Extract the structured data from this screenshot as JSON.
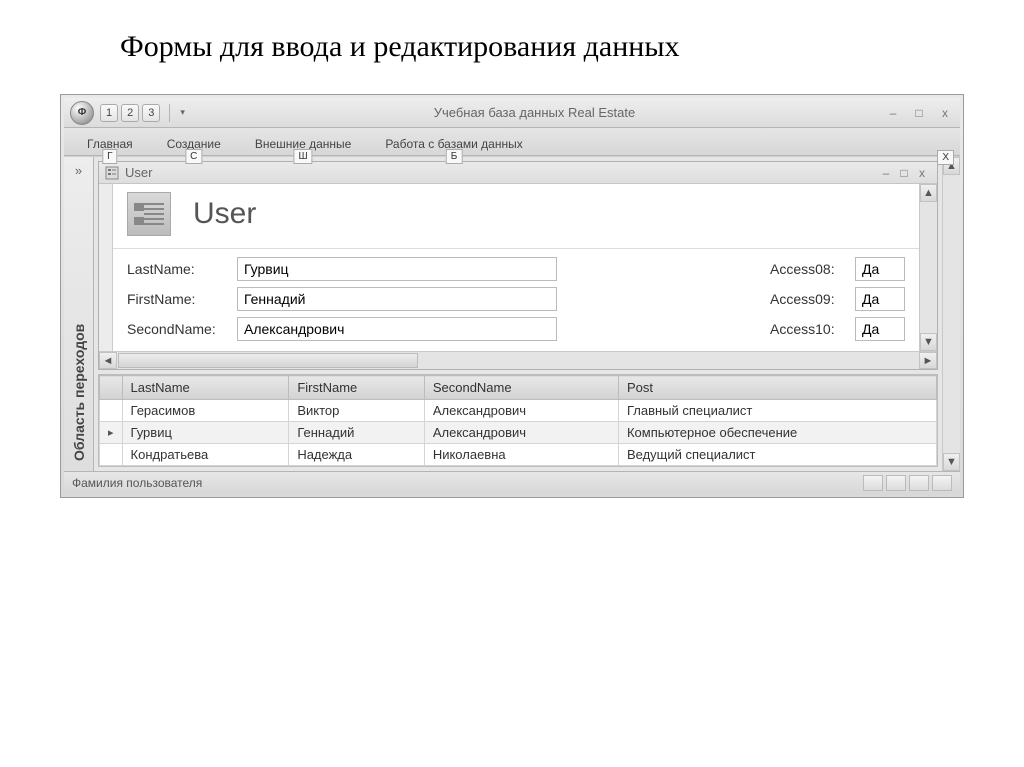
{
  "slide_title": "Формы для ввода и редактирования данных",
  "window": {
    "title": "Учебная база данных Real Estate",
    "orb_letter": "Ф",
    "qat_keys": [
      "1",
      "2",
      "3"
    ]
  },
  "ribbon": {
    "tabs": [
      {
        "label": "Главная",
        "key": "Г"
      },
      {
        "label": "Создание",
        "key": "С"
      },
      {
        "label": "Внешние данные",
        "key": "Ш"
      },
      {
        "label": "Работа с базами данных",
        "key": "Б"
      }
    ],
    "right_key": "X"
  },
  "nav_pane_label": "Область переходов",
  "form": {
    "tab_title": "User",
    "header_title": "User",
    "fields_left": [
      {
        "label": "LastName:",
        "value": "Гурвиц"
      },
      {
        "label": "FirstName:",
        "value": "Геннадий"
      },
      {
        "label": "SecondName:",
        "value": "Александрович"
      }
    ],
    "fields_right": [
      {
        "label": "Access08:",
        "value": "Да"
      },
      {
        "label": "Access09:",
        "value": "Да"
      },
      {
        "label": "Access10:",
        "value": "Да"
      }
    ]
  },
  "grid": {
    "columns": [
      "LastName",
      "FirstName",
      "SecondName",
      "Post"
    ],
    "rows": [
      {
        "cells": [
          "Герасимов",
          "Виктор",
          "Александрович",
          "Главный специалист"
        ],
        "selected": false
      },
      {
        "cells": [
          "Гурвиц",
          "Геннадий",
          "Александрович",
          "Компьютерное обеспечение"
        ],
        "selected": true
      },
      {
        "cells": [
          "Кондратьева",
          "Надежда",
          "Николаевна",
          "Ведущий специалист"
        ],
        "selected": false
      }
    ]
  },
  "status_text": "Фамилия пользователя"
}
